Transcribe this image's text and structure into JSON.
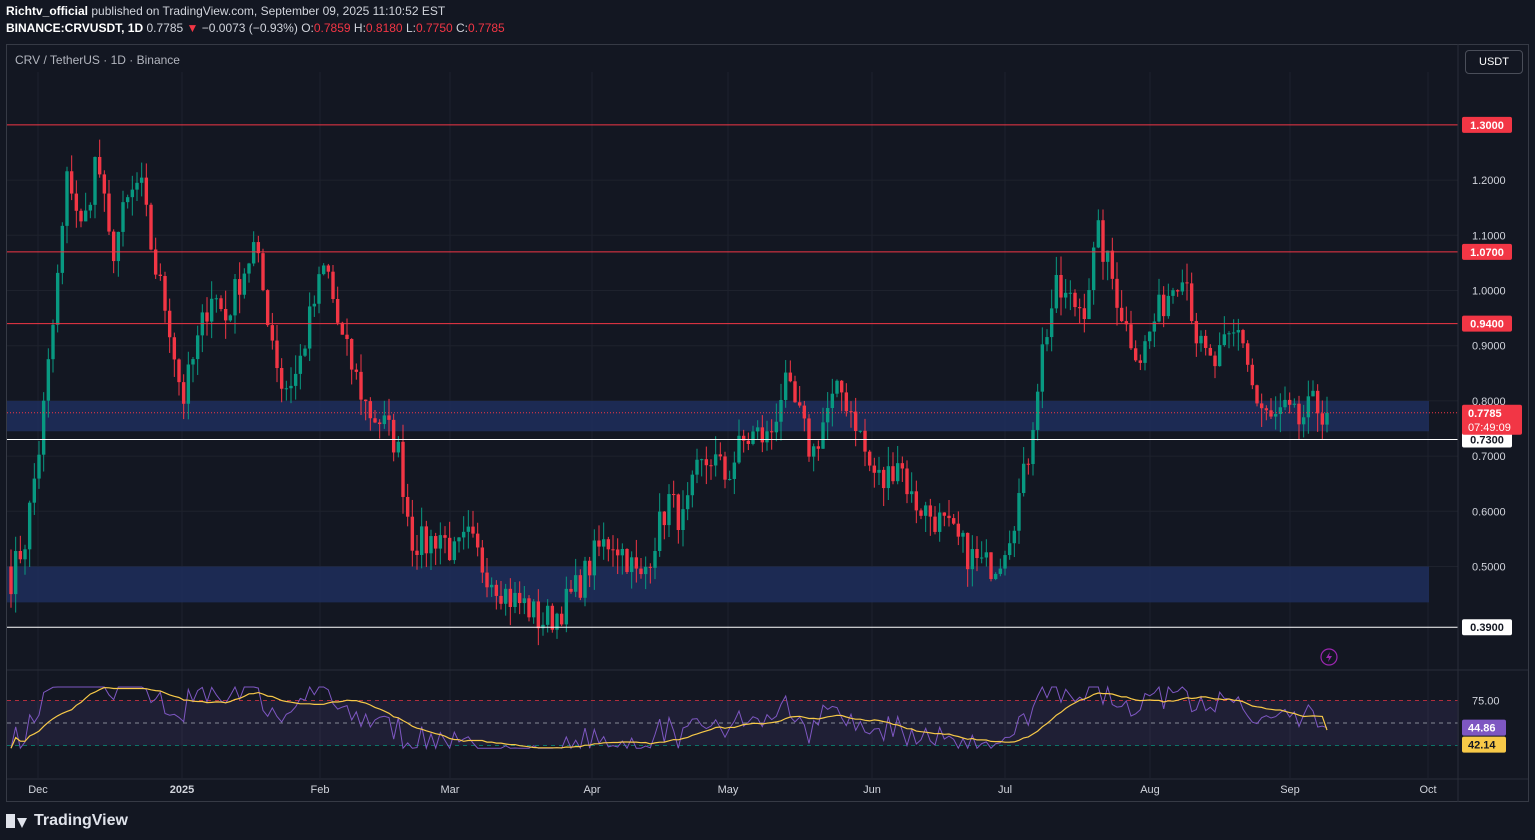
{
  "header": {
    "author": "Richtv_official",
    "published": "published on TradingView.com, September 09, 2025 11:10:52 EST",
    "symbol": "BINANCE:CRVUSDT, 1D",
    "last": "0.7785",
    "arrow": "▼",
    "change": "−0.0073 (−0.93%)",
    "o_label": "O:",
    "o": "0.7859",
    "h_label": "H:",
    "h": "0.8180",
    "l_label": "L:",
    "l": "0.7750",
    "c_label": "C:",
    "c": "0.7785"
  },
  "legend": "CRV / TetherUS · 1D · Binance",
  "currency_button": "USDT",
  "brand": "TradingView",
  "colors": {
    "up": "#089981",
    "down": "#f23645",
    "level_line": "#f23645",
    "zone": "#1e2e5c",
    "rsi_line": "#7e57c2",
    "rsi_ma": "#f7c948",
    "bg": "#131722"
  },
  "chart_data": {
    "type": "candlestick",
    "interval": "1D",
    "price_axis_ticks": [
      "1.2000",
      "1.1000",
      "1.0000",
      "0.9000",
      "0.8000",
      "0.7000",
      "0.6000",
      "0.5000"
    ],
    "time_axis_labels": [
      "Dec",
      "2025",
      "Feb",
      "Mar",
      "Apr",
      "May",
      "Jun",
      "Jul",
      "Aug",
      "Sep",
      "Oct"
    ],
    "ylim": [
      0.36,
      1.39
    ],
    "horizontal_levels": [
      {
        "value": 1.3,
        "label": "1.3000",
        "color": "#f23645"
      },
      {
        "value": 1.07,
        "label": "1.0700",
        "color": "#f23645"
      },
      {
        "value": 0.94,
        "label": "0.9400",
        "color": "#f23645"
      },
      {
        "value": 0.73,
        "label": "0.7300",
        "color": "#ffffff"
      },
      {
        "value": 0.39,
        "label": "0.3900",
        "color": "#ffffff"
      }
    ],
    "zones": [
      {
        "from": 0.745,
        "to": 0.8
      },
      {
        "from": 0.435,
        "to": 0.5
      }
    ],
    "current_price": {
      "value": 0.7785,
      "label": "0.7785",
      "countdown": "07:49:09"
    },
    "price_path_closes": [
      0.48,
      0.55,
      0.72,
      0.95,
      1.22,
      1.1,
      1.25,
      1.06,
      1.15,
      1.2,
      1.05,
      0.95,
      0.8,
      0.9,
      1.0,
      0.95,
      1.02,
      1.08,
      0.95,
      0.82,
      0.85,
      0.96,
      1.05,
      0.92,
      0.85,
      0.78,
      0.76,
      0.72,
      0.55,
      0.54,
      0.56,
      0.52,
      0.55,
      0.5,
      0.47,
      0.44,
      0.43,
      0.4,
      0.41,
      0.44,
      0.48,
      0.53,
      0.55,
      0.52,
      0.47,
      0.55,
      0.62,
      0.58,
      0.67,
      0.7,
      0.66,
      0.72,
      0.74,
      0.73,
      0.83,
      0.78,
      0.7,
      0.78,
      0.82,
      0.77,
      0.68,
      0.65,
      0.7,
      0.62,
      0.6,
      0.58,
      0.55,
      0.52,
      0.5,
      0.51,
      0.58,
      0.68,
      0.88,
      1.0,
      0.98,
      0.97,
      1.1,
      1.02,
      0.93,
      0.88,
      0.95,
      1.0,
      1.05,
      0.9,
      0.86,
      0.9,
      0.93,
      0.8,
      0.76,
      0.78,
      0.76,
      0.79,
      0.7785
    ],
    "rsi": {
      "levels": [
        {
          "value": 75,
          "label": "75.00"
        }
      ],
      "rsi_value": 44.86,
      "rsi_label": "44.86",
      "ma_value": 42.14,
      "ma_label": "42.14"
    }
  }
}
